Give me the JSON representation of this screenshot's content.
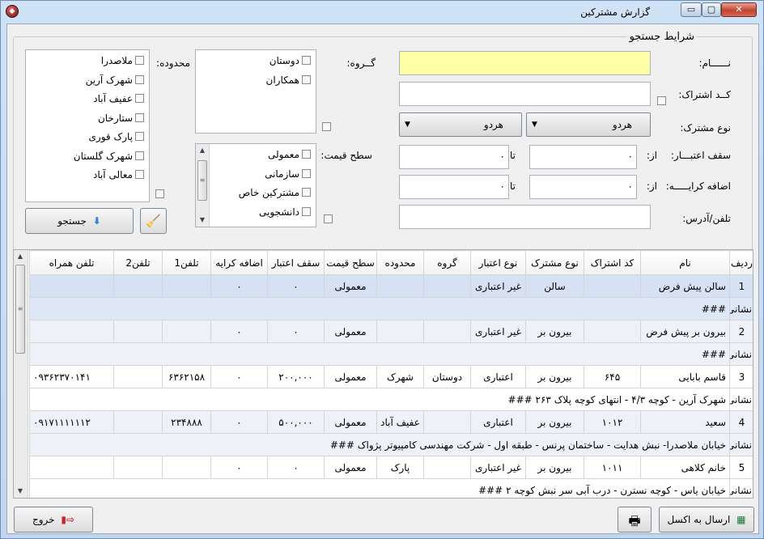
{
  "window": {
    "title": "گزارش مشترکین",
    "min": "▭",
    "max": "▢",
    "close": "✕"
  },
  "search": {
    "group_label": "شرایط جستجو",
    "name_label": "نــــــام:",
    "code_label": "کــد اشتراک:",
    "type_label": "نوع مشترک:",
    "credit_label": "سقف اعتبـــار:",
    "rent_label": "اضافه کرایـــــه:",
    "phone_label": "تلفن/آدرس:",
    "from_label": "از:",
    "to_label": "تا:",
    "credit_from": "۰",
    "credit_to": "۰",
    "rent_from": "۰",
    "rent_to": "۰",
    "type_combo1": "هردو",
    "type_combo2": "هردو",
    "group_filter_label": "گــروه:",
    "groups": [
      "دوستان",
      "همکاران"
    ],
    "price_label": "سطح قیمت:",
    "prices": [
      "معمولی",
      "سازمانی",
      "مشترکین خاص",
      "دانشجویی"
    ],
    "area_label": "محدوده:",
    "areas": [
      "ملاصدرا",
      "شهرک آرین",
      "عفیف آباد",
      "ستارخان",
      "پارک قوری",
      "شهرک گلستان",
      "معالی آباد"
    ],
    "search_button": "جستجو"
  },
  "table": {
    "headers": [
      "ردیف",
      "نام",
      "کد اشتراک",
      "نوع مشترک",
      "نوع اعتبار",
      "گروه",
      "محدوده",
      "سطح قیمت",
      "سقف اعتبار",
      "اضافه کرایه",
      "تلفن1",
      "تلفن2",
      "تلفن همراه"
    ],
    "address_label": "نشانی",
    "rows": [
      {
        "no": "1",
        "name": "سالن پیش فرض",
        "code": "",
        "type": "سالن",
        "credit_type": "غیر اعتباری",
        "group": "",
        "area": "",
        "price": "معمولی",
        "credit": "۰",
        "rent": "۰",
        "tel1": "",
        "tel2": "",
        "mobile": "",
        "address": "###"
      },
      {
        "no": "2",
        "name": "بیرون بر پیش فرض",
        "code": "",
        "type": "بیرون بر",
        "credit_type": "غیر اعتباری",
        "group": "",
        "area": "",
        "price": "معمولی",
        "credit": "۰",
        "rent": "۰",
        "tel1": "",
        "tel2": "",
        "mobile": "",
        "address": "###"
      },
      {
        "no": "3",
        "name": "قاسم بابایی",
        "code": "۶۴۵",
        "type": "بیرون بر",
        "credit_type": "اعتباری",
        "group": "دوستان",
        "area": "شهرک",
        "price": "معمولی",
        "credit": "۲۰۰,۰۰۰",
        "rent": "۰",
        "tel1": "۶۳۶۲۱۵۸",
        "tel2": "",
        "mobile": "۰۹۳۶۲۳۷۰۱۴۱",
        "address": "شهرک آرین - کوچه ۴/۳ - انتهای کوچه پلاک ۲۶۳ ###"
      },
      {
        "no": "4",
        "name": "سعید",
        "code": "۱۰۱۲",
        "type": "بیرون بر",
        "credit_type": "اعتباری",
        "group": "",
        "area": "عفیف آباد",
        "price": "معمولی",
        "credit": "۵۰۰,۰۰۰",
        "rent": "۰",
        "tel1": "۲۳۴۸۸۸",
        "tel2": "",
        "mobile": "۰۹۱۷۱۱۱۱۱۱۲",
        "address": "خیابان ملاصدرا- نبش هدایت - ساختمان پرنس - طبقه اول - شرکت مهندسی کامپیوتر پژواک ###"
      },
      {
        "no": "5",
        "name": "خانم کلاهی",
        "code": "۱۰۱۱",
        "type": "بیرون بر",
        "credit_type": "غیر اعتباری",
        "group": "",
        "area": "پارک",
        "price": "معمولی",
        "credit": "۰",
        "rent": "۰",
        "tel1": "",
        "tel2": "",
        "mobile": "",
        "address": "خیابان یاس - کوچه نسترن - درب آبی سر نبش کوچه ۲ ###"
      }
    ]
  },
  "footer": {
    "exit_button": "خروج",
    "excel_button": "ارسال به اکسل"
  },
  "colors": {
    "name_field": "#ffffa8",
    "selected_row": "#dde7f6"
  },
  "icons": {
    "app": "app-icon",
    "search": "arrow-down-icon",
    "clear": "broom-icon",
    "print": "printer-icon",
    "excel": "excel-icon",
    "exit": "exit-door-icon"
  }
}
